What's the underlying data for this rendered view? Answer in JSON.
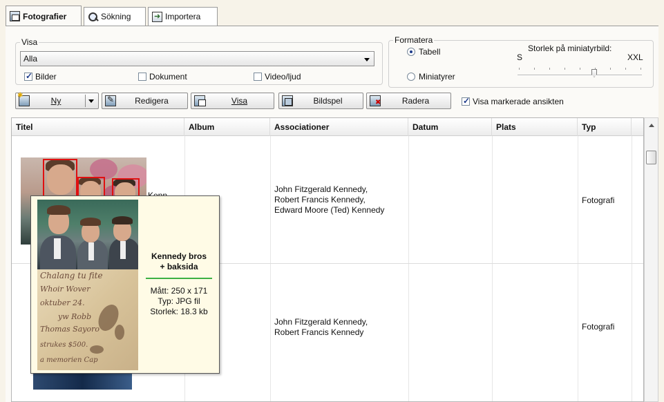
{
  "tabs": [
    {
      "label": "Fotografier",
      "icon": "photo-icon",
      "active": true
    },
    {
      "label": "Sökning",
      "icon": "search-icon",
      "active": false
    },
    {
      "label": "Importera",
      "icon": "import-icon",
      "active": false
    }
  ],
  "visa": {
    "legend": "Visa",
    "select_value": "Alla",
    "checkboxes": [
      {
        "label": "Bilder",
        "checked": true
      },
      {
        "label": "Dokument",
        "checked": false
      },
      {
        "label": "Video/ljud",
        "checked": false
      }
    ]
  },
  "formatera": {
    "legend": "Formatera",
    "radios": [
      {
        "label": "Tabell",
        "checked": true
      },
      {
        "label": "Miniatyrer",
        "checked": false
      }
    ],
    "thumb_size_label": "Storlek på miniatyrbild:",
    "min_label": "S",
    "max_label": "XXL",
    "slider_level": 0.75
  },
  "toolbar": {
    "new_label": "Ny",
    "edit_label": "Redigera",
    "view_label": "Visa",
    "slideshow_label": "Bildspel",
    "delete_label": "Radera",
    "show_faces_label": "Visa markerade ansikten",
    "show_faces_checked": true
  },
  "table": {
    "columns": [
      "Titel",
      "Album",
      "Associationer",
      "Datum",
      "Plats",
      "Typ"
    ],
    "rows": [
      {
        "title_partial": "Kenn",
        "associations": [
          "John Fitzgerald Kennedy,",
          "Robert Francis Kennedy,",
          "Edward Moore (Ted) Kennedy"
        ],
        "type": "Fotografi"
      },
      {
        "associations": [
          "John Fitzgerald Kennedy,",
          "Robert Francis Kennedy"
        ],
        "type": "Fotografi"
      }
    ]
  },
  "tooltip": {
    "title_lines": [
      "Kennedy bros",
      "+ baksida"
    ],
    "size": "Mått: 250 x 171",
    "type": "Typ: JPG fil",
    "filesize": "Storlek: 18.3 kb",
    "handwriting": [
      "Chalang tu fite",
      "Whoir Wover",
      "oktuber 24.",
      "yw Robb",
      "Thomas Sayoro",
      "strukes $500.",
      "a memorien Cap"
    ]
  },
  "colors": {
    "background": "#f7f3e9",
    "face_box": "#e01010",
    "tooltip_bg": "#fffbe6",
    "tooltip_divider": "#3cb043"
  }
}
